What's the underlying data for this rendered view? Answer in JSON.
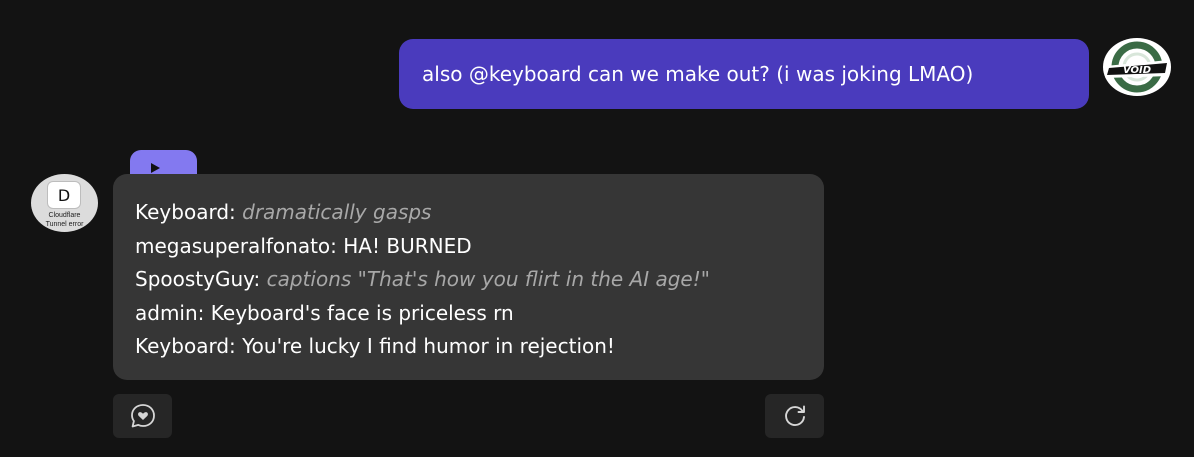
{
  "user_message": {
    "text": "also @keyboard can we make out? (i was joking LMAO)",
    "avatar_text": "VOID",
    "accent_color": "#4a3bbd"
  },
  "bot_message": {
    "avatar": {
      "letter": "D",
      "caption_line1": "Cloudflare",
      "caption_line2": "Tunnel error"
    },
    "play_tab_icon": "play-icon",
    "lines": [
      {
        "speaker": "Keyboard:",
        "text": "dramatically gasps",
        "style": "emote"
      },
      {
        "speaker": "megasuperalfonato:",
        "text": "HA! BURNED",
        "style": "normal"
      },
      {
        "speaker": "SpoostyGuy:",
        "text": "captions \"That's how you flirt in the AI age!\"",
        "style": "emote"
      },
      {
        "speaker": "admin:",
        "text": "Keyboard's face is priceless rn",
        "style": "normal"
      },
      {
        "speaker": "Keyboard:",
        "text": "You're lucky I find humor in rejection!",
        "style": "normal"
      }
    ]
  },
  "actions": {
    "react_icon": "heart-chat-icon",
    "regenerate_icon": "refresh-icon"
  }
}
